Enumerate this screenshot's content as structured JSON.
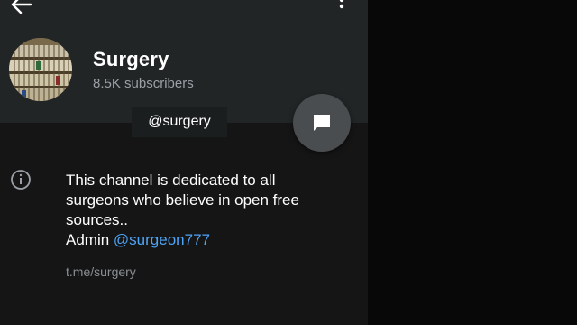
{
  "header": {
    "title": "Surgery",
    "subscribers": "8.5K subscribers",
    "back_icon": "arrow-left-icon",
    "menu_icon": "more-vert-icon"
  },
  "channel": {
    "username": "@surgery",
    "description_lines": [
      "This channel is dedicated to all",
      "surgeons who believe in open free",
      "sources.."
    ],
    "admin_prefix": "Admin ",
    "admin_handle": "@surgeon777",
    "link": "t.me/surgery"
  },
  "icons": {
    "fab": "message-icon",
    "info": "info-icon"
  },
  "colors": {
    "background": "#151515",
    "header": "#222526",
    "accent_link": "#4ea4f6",
    "secondary_text": "#9aa0a6",
    "fab": "#4a4d50"
  }
}
